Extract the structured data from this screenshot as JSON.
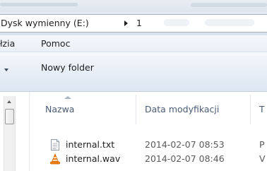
{
  "address": {
    "drive_label": "Dysk wymienny (E:)",
    "folder_label": "1"
  },
  "menu": {
    "items": [
      {
        "label": "łzia"
      },
      {
        "label": "Pomoc"
      }
    ]
  },
  "command_bar": {
    "new_folder_label": "Nowy folder"
  },
  "file_list": {
    "columns": [
      {
        "label": "Nazwa",
        "sorted": "ascending"
      },
      {
        "label": "Data modyfikacji"
      },
      {
        "label": "T"
      }
    ],
    "rows": [
      {
        "name": "internal.txt",
        "date": "2014-02-07 08:53",
        "type": "P",
        "icon": "text-file-icon"
      },
      {
        "name": "internal.wav",
        "date": "2014-02-07 08:46",
        "type": "V",
        "icon": "vlc-media-file-icon"
      }
    ]
  },
  "colors": {
    "header_text": "#4b5c74",
    "chrome_blue": "#dde6f1",
    "vlc_orange": "#f0820a"
  }
}
